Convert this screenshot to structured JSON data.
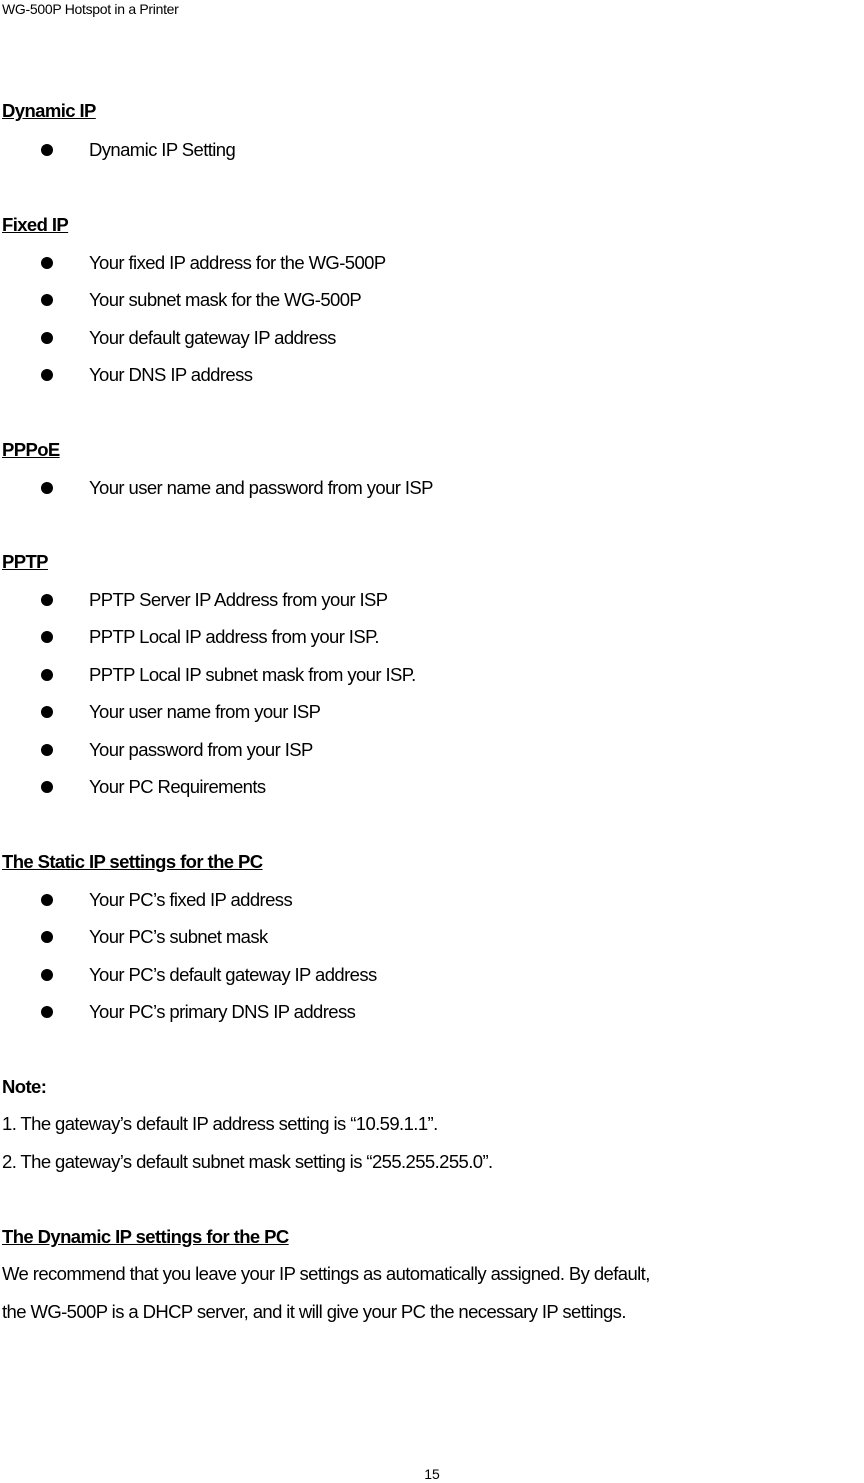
{
  "header": {
    "title": "WG-500P Hotspot in a Printer"
  },
  "sections": {
    "dynamic_ip": {
      "heading": "Dynamic IP",
      "items": [
        "Dynamic IP Setting"
      ]
    },
    "fixed_ip": {
      "heading": "Fixed IP",
      "items": [
        "Your fixed IP address for the WG-500P",
        "Your subnet mask for the WG-500P",
        "Your default gateway IP address",
        "Your DNS IP address"
      ]
    },
    "pppoe": {
      "heading": "PPPoE",
      "items": [
        "Your user name and password from your ISP"
      ]
    },
    "pptp": {
      "heading": "PPTP",
      "items": [
        "PPTP Server IP Address from your ISP",
        "PPTP Local IP address from your ISP.",
        "PPTP Local IP subnet mask from your ISP.",
        "Your user name from your ISP",
        "Your password from your ISP",
        "Your PC Requirements"
      ]
    },
    "static_pc": {
      "heading": "The Static IP settings for the PC",
      "items": [
        "Your PC’s fixed IP address",
        "Your PC’s subnet mask",
        "Your PC’s default gateway IP address",
        "Your PC’s primary DNS IP address"
      ]
    },
    "note": {
      "label": "Note:",
      "lines": [
        "1. The gateway’s default IP address setting is “10.59.1.1”.",
        "2. The gateway’s default subnet mask setting is “255.255.255.0”."
      ]
    },
    "dynamic_pc": {
      "heading": "The Dynamic IP settings for the PC",
      "lines": [
        "We recommend that you leave your IP settings as automatically assigned. By default,",
        "the WG-500P is a DHCP server, and it will give your PC the necessary IP settings."
      ]
    }
  },
  "footer": {
    "page_number": "15"
  }
}
